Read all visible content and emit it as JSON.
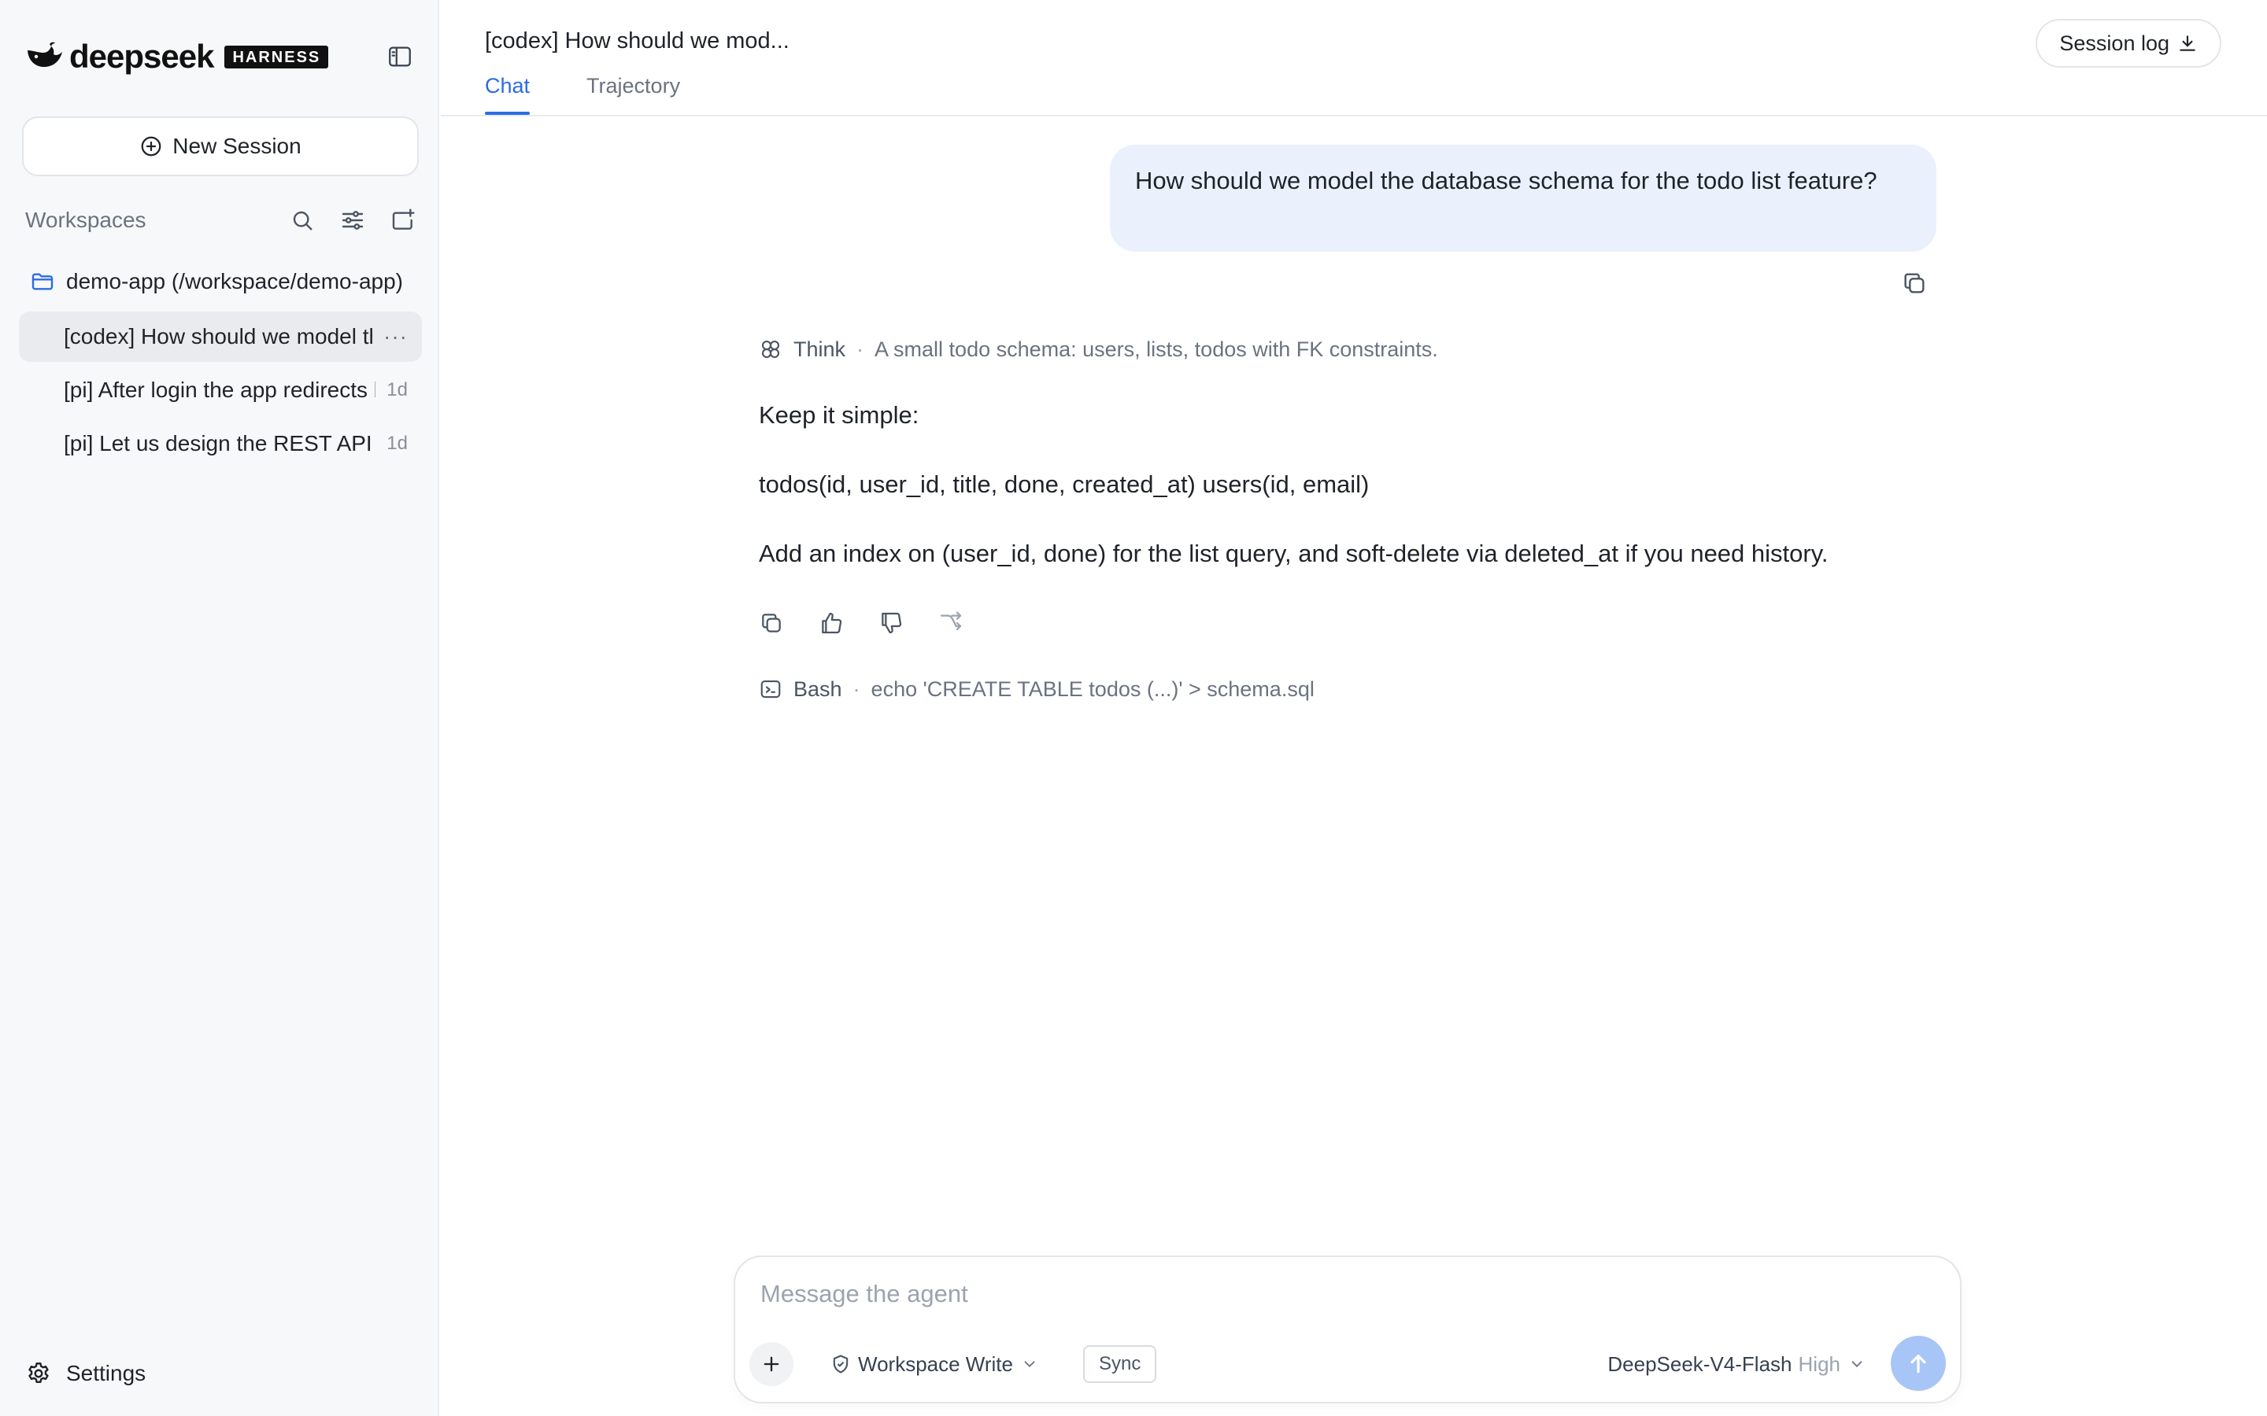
{
  "brand": {
    "name": "deepseek",
    "badge": "HARNESS"
  },
  "sidebar": {
    "new_session_label": "New Session",
    "workspaces_title": "Workspaces",
    "workspace": {
      "label": "demo-app (/workspace/demo-app)"
    },
    "sessions": [
      {
        "label": "[codex] How should we model the database schema for the todo list feature?",
        "age": "",
        "active": true
      },
      {
        "label": "[pi] After login the app redirects back to the login page",
        "age": "1d",
        "active": false
      },
      {
        "label": "[pi] Let us design the REST API for todos",
        "age": "1d",
        "active": false
      }
    ],
    "settings_label": "Settings"
  },
  "header": {
    "title": "[codex] How should we mod...",
    "tabs": [
      {
        "label": "Chat",
        "active": true
      },
      {
        "label": "Trajectory",
        "active": false
      }
    ],
    "session_log_label": "Session log"
  },
  "chat": {
    "user_message": "How should we model the database schema for the todo list feature?",
    "think": {
      "label": "Think",
      "summary": "A small todo schema: users, lists, todos with FK constraints."
    },
    "reply": [
      "Keep it simple:",
      "todos(id, user_id, title, done, created_at) users(id, email)",
      "Add an index on (user_id, done) for the list query, and soft-delete via deleted_at if you need history."
    ],
    "bash": {
      "label": "Bash",
      "command": "echo 'CREATE TABLE todos (...)' > schema.sql"
    }
  },
  "composer": {
    "placeholder": "Message the agent",
    "mode": "Workspace Write",
    "sync_label": "Sync",
    "model": "DeepSeek-V4-Flash",
    "effort": "High"
  },
  "colors": {
    "accent": "#2b6be6",
    "user_bubble": "#eaf1fd",
    "send_button": "#a8c5f7",
    "sidebar_bg": "#f7f8fa"
  },
  "icons": [
    "whale-logo-icon",
    "sidebar-toggle-icon",
    "plus-circle-icon",
    "search-icon",
    "filter-icon",
    "new-folder-icon",
    "folder-icon",
    "more-icon",
    "gear-icon",
    "download-icon",
    "copy-icon",
    "thumbs-up-icon",
    "thumbs-down-icon",
    "branch-icon",
    "brain-icon",
    "terminal-icon",
    "plus-icon",
    "shield-icon",
    "chevron-down-icon",
    "arrow-up-icon"
  ]
}
